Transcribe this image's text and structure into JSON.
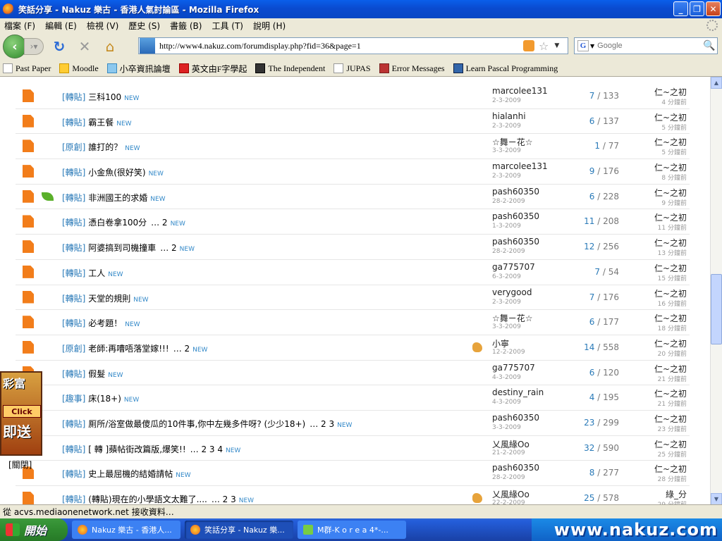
{
  "window": {
    "title": "笑話分享 - Nakuz 樂古 - 香港人氣討論區 - Mozilla Firefox"
  },
  "menu": [
    "檔案 (F)",
    "編輯 (E)",
    "檢視 (V)",
    "歷史 (S)",
    "書籤 (B)",
    "工具 (T)",
    "說明 (H)"
  ],
  "nav": {
    "url": "http://www4.nakuz.com/forumdisplay.php?fid=36&page=1",
    "search_placeholder": "Google",
    "search_engine": "G"
  },
  "bookmarks": [
    {
      "label": "Past Paper",
      "icon": "page-icon"
    },
    {
      "label": "Moodle",
      "icon": "moodle-icon"
    },
    {
      "label": "小卒資訊論壇",
      "icon": "forum-icon"
    },
    {
      "label": "英文由F字學起",
      "icon": "yahoo-icon"
    },
    {
      "label": "The Independent",
      "icon": "eagle-icon"
    },
    {
      "label": "JUPAS",
      "icon": "page-icon"
    },
    {
      "label": "Error Messages",
      "icon": "error-icon"
    },
    {
      "label": "Learn Pascal Programming",
      "icon": "pascal-icon"
    }
  ],
  "threads": [
    {
      "tag": "[轉貼]",
      "title": "三科100",
      "pages": "",
      "new": "NEW",
      "leaf": false,
      "thumb": false,
      "author": "marcolee131",
      "date": "2-3-2009",
      "replies": "7",
      "views": "133",
      "last": "仁~之初",
      "ago": "4 分鐘前"
    },
    {
      "tag": "[轉貼]",
      "title": "霸王餐",
      "pages": "",
      "new": "NEW",
      "leaf": false,
      "thumb": false,
      "author": "hialanhi",
      "date": "2-3-2009",
      "replies": "6",
      "views": "137",
      "last": "仁~之初",
      "ago": "5 分鐘前"
    },
    {
      "tag": "[原創]",
      "title": "誰打的？",
      "pages": "",
      "new": "NEW",
      "leaf": false,
      "thumb": false,
      "author": "☆舞ㄧ花☆",
      "date": "3-3-2009",
      "replies": "1",
      "views": "77",
      "last": "仁~之初",
      "ago": "5 分鐘前"
    },
    {
      "tag": "[轉貼]",
      "title": "小金魚(很好笑)",
      "pages": "",
      "new": "NEW",
      "leaf": false,
      "thumb": false,
      "author": "marcolee131",
      "date": "2-3-2009",
      "replies": "9",
      "views": "176",
      "last": "仁~之初",
      "ago": "8 分鐘前"
    },
    {
      "tag": "[轉貼]",
      "title": "非洲國王的求婚",
      "pages": "",
      "new": "NEW",
      "leaf": true,
      "thumb": false,
      "author": "pash60350",
      "date": "28-2-2009",
      "replies": "6",
      "views": "228",
      "last": "仁~之初",
      "ago": "9 分鐘前"
    },
    {
      "tag": "[轉貼]",
      "title": "憑白卷拿100分",
      "pages": "… 2",
      "new": "NEW",
      "leaf": false,
      "thumb": false,
      "author": "pash60350",
      "date": "1-3-2009",
      "replies": "11",
      "views": "208",
      "last": "仁~之初",
      "ago": "11 分鐘前"
    },
    {
      "tag": "[轉貼]",
      "title": "阿婆搞到司機撞車",
      "pages": "… 2",
      "new": "NEW",
      "leaf": false,
      "thumb": false,
      "author": "pash60350",
      "date": "28-2-2009",
      "replies": "12",
      "views": "256",
      "last": "仁~之初",
      "ago": "13 分鐘前"
    },
    {
      "tag": "[轉貼]",
      "title": "工人",
      "pages": "",
      "new": "NEW",
      "leaf": false,
      "thumb": false,
      "author": "ga775707",
      "date": "6-3-2009",
      "replies": "7",
      "views": "54",
      "last": "仁~之初",
      "ago": "15 分鐘前"
    },
    {
      "tag": "[轉貼]",
      "title": "天堂的規則",
      "pages": "",
      "new": "NEW",
      "leaf": false,
      "thumb": false,
      "author": "verygood",
      "date": "2-3-2009",
      "replies": "7",
      "views": "176",
      "last": "仁~之初",
      "ago": "16 分鐘前"
    },
    {
      "tag": "[轉貼]",
      "title": "必考題！",
      "pages": "",
      "new": "NEW",
      "leaf": false,
      "thumb": false,
      "author": "☆舞ㄧ花☆",
      "date": "3-3-2009",
      "replies": "6",
      "views": "177",
      "last": "仁~之初",
      "ago": "18 分鐘前"
    },
    {
      "tag": "[原創]",
      "title": "老師:再嘈唔落堂嫁!!!",
      "pages": "… 2",
      "new": "NEW",
      "leaf": false,
      "thumb": true,
      "author": "小寧",
      "date": "12-2-2009",
      "replies": "14",
      "views": "558",
      "last": "仁~之初",
      "ago": "20 分鐘前"
    },
    {
      "tag": "[轉貼]",
      "title": "假髮",
      "pages": "",
      "new": "NEW",
      "leaf": false,
      "thumb": false,
      "author": "ga775707",
      "date": "4-3-2009",
      "replies": "6",
      "views": "120",
      "last": "仁~之初",
      "ago": "21 分鐘前"
    },
    {
      "tag": "[趣事]",
      "title": "床(18+)",
      "pages": "",
      "new": "NEW",
      "leaf": false,
      "thumb": false,
      "author": "destiny_rain",
      "date": "4-3-2009",
      "replies": "4",
      "views": "195",
      "last": "仁~之初",
      "ago": "21 分鐘前"
    },
    {
      "tag": "[轉貼]",
      "title": "厠所/浴室做最傻瓜的10件事,你中左幾多件呀? (少少18+)",
      "pages": "… 2 3",
      "new": "NEW",
      "leaf": false,
      "thumb": false,
      "author": "pash60350",
      "date": "3-3-2009",
      "replies": "23",
      "views": "299",
      "last": "仁~之初",
      "ago": "23 分鐘前"
    },
    {
      "tag": "[轉貼]",
      "title": "[ 轉 ]蘋帖街改篇版,爆笑!!",
      "pages": "… 2 3 4",
      "new": "NEW",
      "leaf": false,
      "thumb": false,
      "author": "乂風緣Oo",
      "date": "21-2-2009",
      "replies": "32",
      "views": "590",
      "last": "仁~之初",
      "ago": "25 分鐘前"
    },
    {
      "tag": "[轉貼]",
      "title": "史上最屈機的結婚請帖",
      "pages": "",
      "new": "NEW",
      "leaf": false,
      "thumb": false,
      "author": "pash60350",
      "date": "28-2-2009",
      "replies": "8",
      "views": "277",
      "last": "仁~之初",
      "ago": "28 分鐘前"
    },
    {
      "tag": "[轉貼]",
      "title": "(轉貼)現在的小學語文太難了....",
      "pages": "… 2 3",
      "new": "NEW",
      "leaf": false,
      "thumb": true,
      "author": "乂風緣Oo",
      "date": "22-2-2009",
      "replies": "25",
      "views": "578",
      "last": "綠_分",
      "ago": "29 分鐘前"
    }
  ],
  "ad": {
    "line1": "彩富",
    "click": "Click",
    "line2": "即送",
    "close": "[關閉]"
  },
  "status": "從 acvs.mediaonenetwork.net 接收資料…",
  "taskbar": {
    "start": "開始",
    "tasks": [
      {
        "label": "Nakuz 樂古 - 香港人...",
        "active": false,
        "icon": "firefox"
      },
      {
        "label": "笑話分享 - Nakuz 樂...",
        "active": true,
        "icon": "firefox"
      },
      {
        "label": "M群-K o r e a 4*-...",
        "active": false,
        "icon": "msn"
      }
    ],
    "tray_text": "www.nakuz.com"
  }
}
